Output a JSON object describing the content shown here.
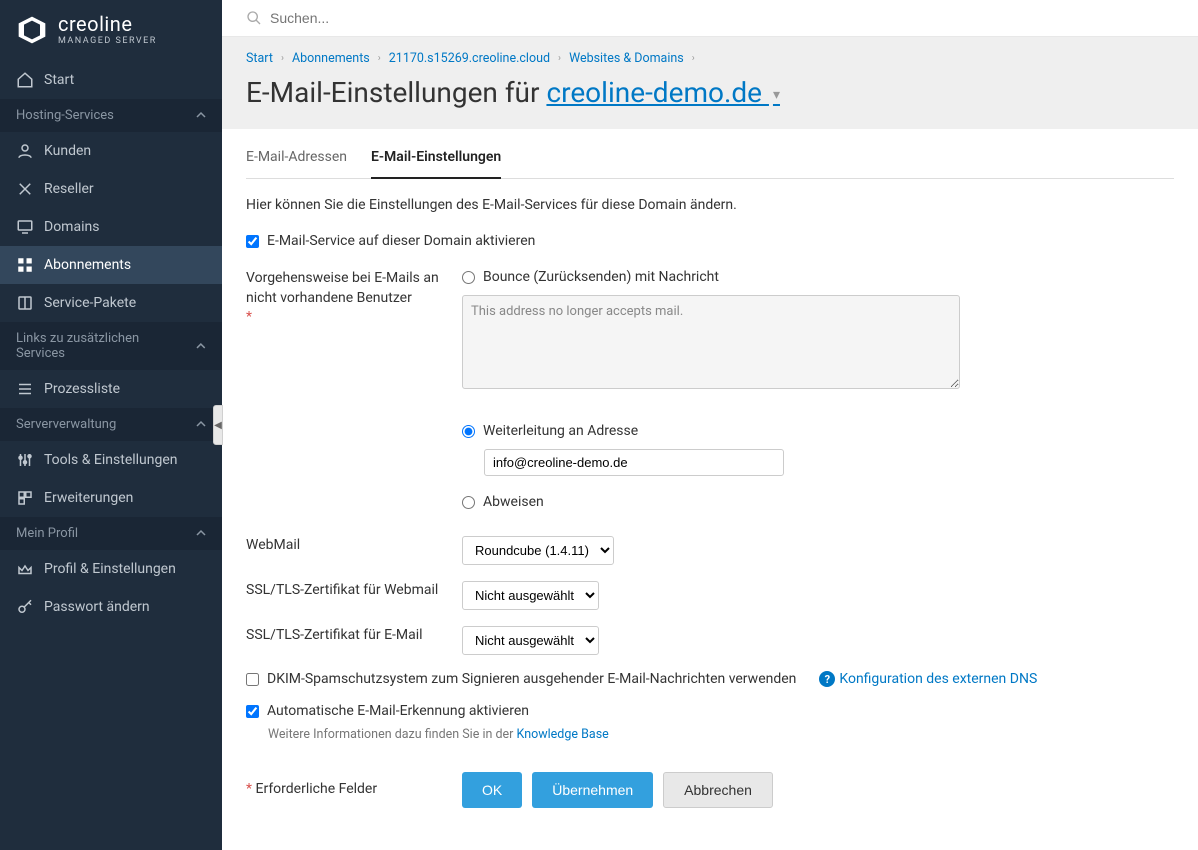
{
  "logo": {
    "main": "creoline",
    "sub": "MANAGED SERVER"
  },
  "search": {
    "placeholder": "Suchen..."
  },
  "sidebar": {
    "start": "Start",
    "sections": {
      "hosting": {
        "label": "Hosting-Services",
        "items": [
          "Kunden",
          "Reseller",
          "Domains",
          "Abonnements",
          "Service-Pakete"
        ]
      },
      "links": {
        "label": "Links zu zusätzlichen Services",
        "items": [
          "Prozessliste"
        ]
      },
      "server": {
        "label": "Serververwaltung",
        "items": [
          "Tools & Einstellungen",
          "Erweiterungen"
        ]
      },
      "profile": {
        "label": "Mein Profil",
        "items": [
          "Profil & Einstellungen",
          "Passwort ändern"
        ]
      }
    }
  },
  "breadcrumb": [
    "Start",
    "Abonnements",
    "21170.s15269.creoline.cloud",
    "Websites & Domains"
  ],
  "page_title": {
    "prefix": "E-Mail-Einstellungen für ",
    "domain": "creoline-demo.de"
  },
  "tabs": {
    "addresses": "E-Mail-Adressen",
    "settings": "E-Mail-Einstellungen"
  },
  "intro": "Hier können Sie die Einstellungen des E-Mail-Services für diese Domain ändern.",
  "form": {
    "enable_service": "E-Mail-Service auf dieser Domain aktivieren",
    "nonexistent_label": "Vorgehensweise bei E-Mails an nicht vorhandene Benutzer",
    "bounce_label": "Bounce (Zurücksenden) mit Nachricht",
    "bounce_text": "This address no longer accepts mail.",
    "forward_label": "Weiterleitung an Adresse",
    "forward_value": "info@creoline-demo.de",
    "reject_label": "Abweisen",
    "webmail_label": "WebMail",
    "webmail_option": "Roundcube (1.4.11)",
    "ssl_webmail_label": "SSL/TLS-Zertifikat für Webmail",
    "ssl_email_label": "SSL/TLS-Zertifikat für E-Mail",
    "not_selected": "Nicht ausgewählt",
    "dkim_label": "DKIM-Spamschutzsystem zum Signieren ausgehender E-Mail-Nachrichten verwenden",
    "ext_dns": "Konfiguration des externen DNS",
    "autodiscover": "Automatische E-Mail-Erkennung aktivieren",
    "autodiscover_hint_prefix": "Weitere Informationen dazu finden Sie in der ",
    "autodiscover_hint_link": "Knowledge Base",
    "required": "Erforderliche Felder",
    "ok": "OK",
    "apply": "Übernehmen",
    "cancel": "Abbrechen"
  }
}
